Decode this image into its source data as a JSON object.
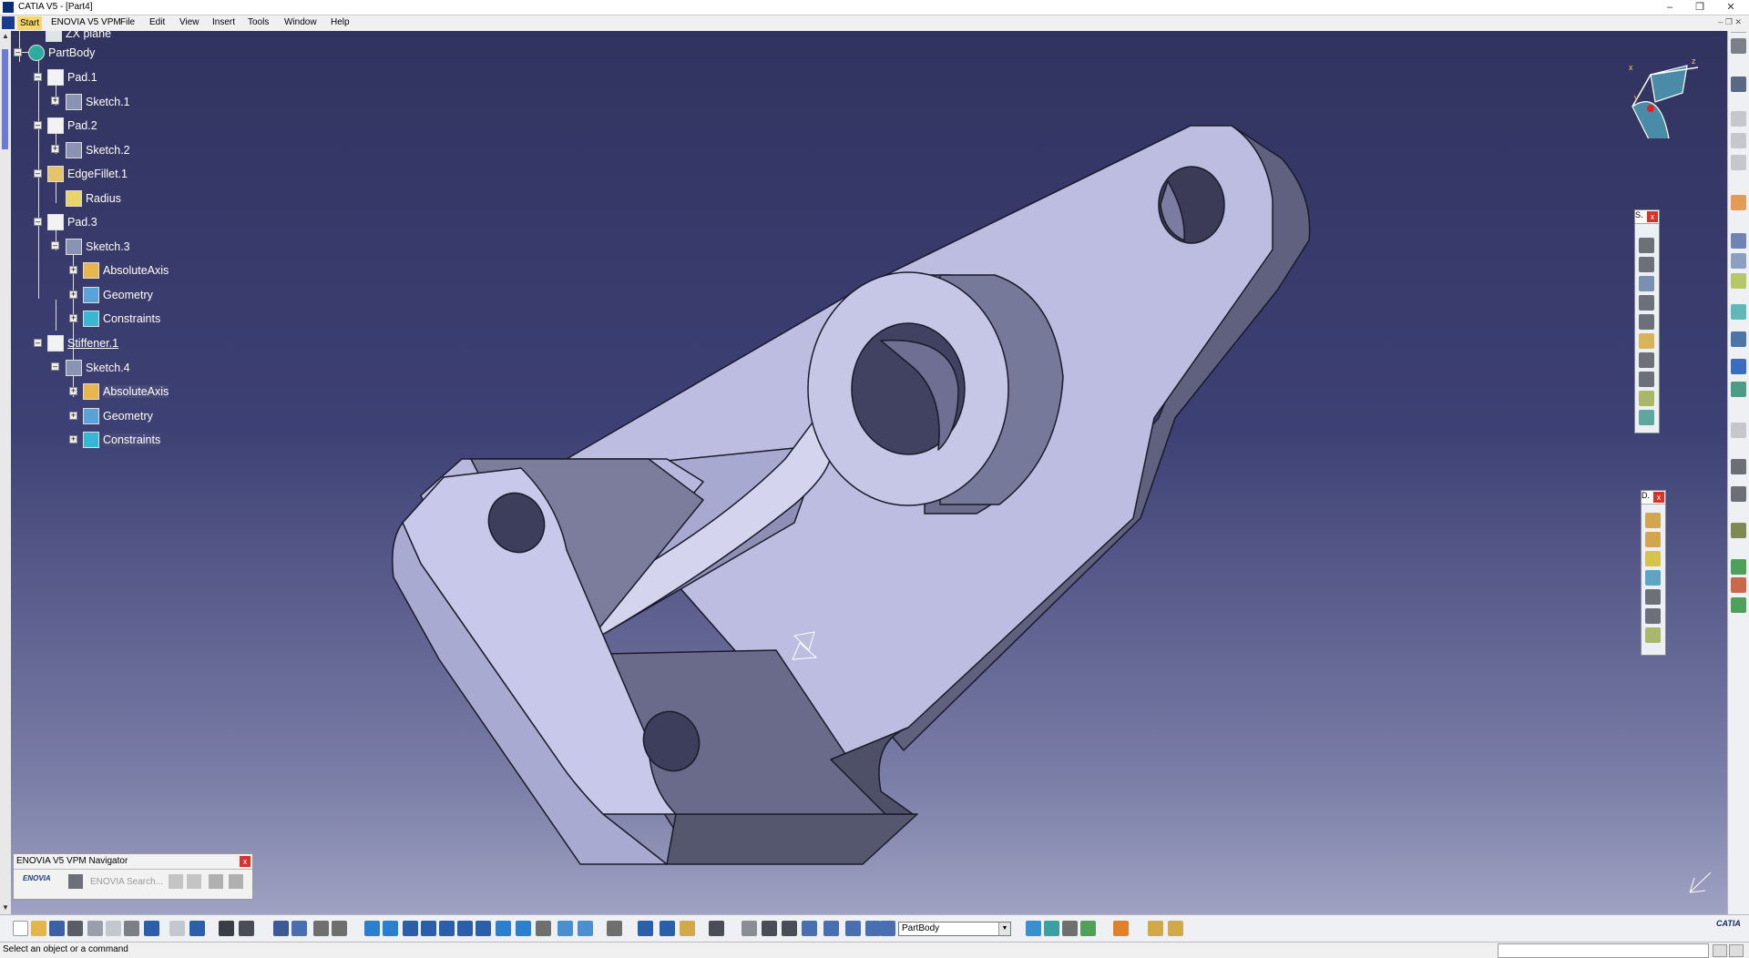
{
  "window": {
    "title": "CATIA V5 - [Part4]",
    "minimize": "–",
    "restore": "❐",
    "close": "✕"
  },
  "menu": {
    "items": [
      "Start",
      "ENOVIA V5 VPM",
      "File",
      "Edit",
      "View",
      "Insert",
      "Tools",
      "Window",
      "Help"
    ],
    "mdi_controls": "– ❐ ✕"
  },
  "tree": {
    "nodes": [
      {
        "label": "ZX plane"
      },
      {
        "label": "PartBody"
      },
      {
        "label": "Pad.1"
      },
      {
        "label": "Sketch.1"
      },
      {
        "label": "Pad.2"
      },
      {
        "label": "Sketch.2"
      },
      {
        "label": "EdgeFillet.1"
      },
      {
        "label": "Radius"
      },
      {
        "label": "Pad.3"
      },
      {
        "label": "Sketch.3"
      },
      {
        "label": "AbsoluteAxis"
      },
      {
        "label": "Geometry"
      },
      {
        "label": "Constraints"
      },
      {
        "label": "Stiffener.1"
      },
      {
        "label": "Sketch.4"
      },
      {
        "label": "AbsoluteAxis"
      },
      {
        "label": "Geometry"
      },
      {
        "label": "Constraints"
      }
    ]
  },
  "compass": {
    "x": "x",
    "y": "y",
    "z": "z"
  },
  "toolbar_sketcher": {
    "title": "S."
  },
  "toolbar_dressup": {
    "title": "D."
  },
  "navigator": {
    "title": "ENOVIA V5 VPM Navigator",
    "search_label": "ENOVIA Search...",
    "logo_text": "ENOVIA"
  },
  "bottom_toolbar": {
    "current_body": "PartBody"
  },
  "brand": {
    "logo_text": "CATIA"
  },
  "status": {
    "message": "Select an object or a command"
  }
}
